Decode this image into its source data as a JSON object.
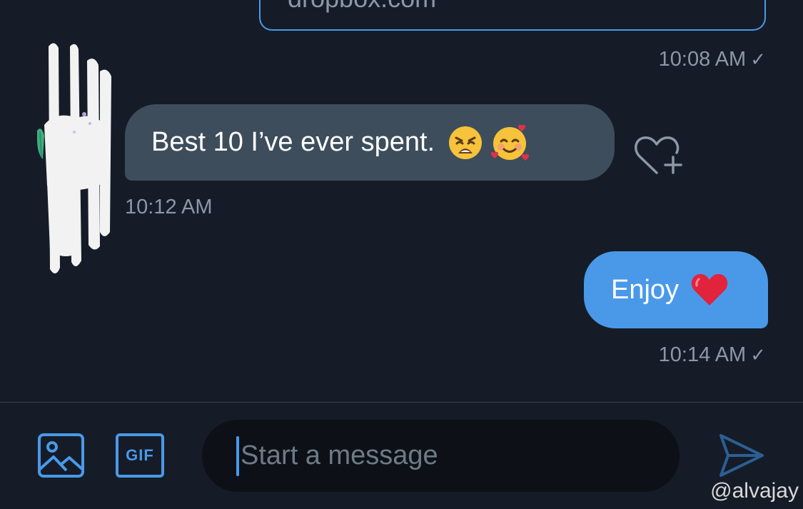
{
  "conversation": {
    "previous_card": {
      "link_text": "dropbox.com",
      "time": "10:08 AM",
      "status_icon": "check-icon"
    },
    "messages": [
      {
        "direction": "incoming",
        "text": "Best 10 I’ve ever spent.",
        "emojis": [
          "weary-face-emoji",
          "smiling-face-with-hearts-emoji"
        ],
        "time": "10:12 AM",
        "reaction_icon": "heart-plus-icon"
      },
      {
        "direction": "outgoing",
        "text": "Enjoy",
        "emojis": [
          "red-heart-emoji"
        ],
        "time": "10:14 AM",
        "status_icon": "check-icon"
      }
    ]
  },
  "composer": {
    "media_icon": "image-icon",
    "gif_label": "GIF",
    "placeholder": "Start a message",
    "send_icon": "send-icon"
  },
  "watermark": "@alvajay",
  "colors": {
    "background": "#151c27",
    "incoming_bubble": "#3d4d5c",
    "outgoing_bubble": "#4a99e9",
    "accent": "#4a99e9",
    "muted_text": "#8b98a5"
  }
}
